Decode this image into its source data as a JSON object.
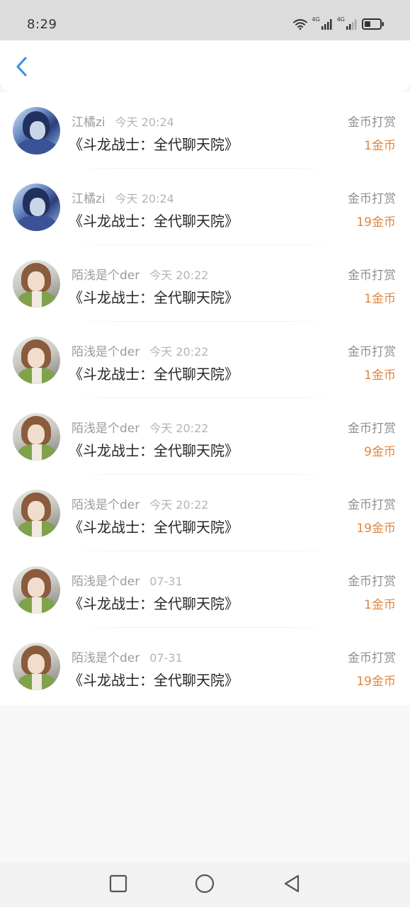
{
  "status_bar": {
    "time": "8:29",
    "network_1": "4G",
    "network_2": "4G",
    "icons": [
      "wifi-icon",
      "signal-icon",
      "signal-icon",
      "battery-icon"
    ]
  },
  "header": {
    "back_icon": "chevron-left-icon"
  },
  "records": [
    {
      "avatar": "blue",
      "name": "江橘zi",
      "time": "今天 20:24",
      "content": "《斗龙战士：全代聊天院》",
      "type": "金币打赏",
      "amount": "1金币"
    },
    {
      "avatar": "blue",
      "name": "江橘zi",
      "time": "今天 20:24",
      "content": "《斗龙战士：全代聊天院》",
      "type": "金币打赏",
      "amount": "19金币"
    },
    {
      "avatar": "green",
      "name": "陌浅是个der",
      "time": "今天 20:22",
      "content": "《斗龙战士：全代聊天院》",
      "type": "金币打赏",
      "amount": "1金币"
    },
    {
      "avatar": "green",
      "name": "陌浅是个der",
      "time": "今天 20:22",
      "content": "《斗龙战士：全代聊天院》",
      "type": "金币打赏",
      "amount": "1金币"
    },
    {
      "avatar": "green",
      "name": "陌浅是个der",
      "time": "今天 20:22",
      "content": "《斗龙战士：全代聊天院》",
      "type": "金币打赏",
      "amount": "9金币"
    },
    {
      "avatar": "green",
      "name": "陌浅是个der",
      "time": "今天 20:22",
      "content": "《斗龙战士：全代聊天院》",
      "type": "金币打赏",
      "amount": "19金币"
    },
    {
      "avatar": "green",
      "name": "陌浅是个der",
      "time": "07-31",
      "content": "《斗龙战士：全代聊天院》",
      "type": "金币打赏",
      "amount": "1金币"
    },
    {
      "avatar": "green",
      "name": "陌浅是个der",
      "time": "07-31",
      "content": "《斗龙战士：全代聊天院》",
      "type": "金币打赏",
      "amount": "19金币"
    }
  ],
  "nav_bar": {
    "icons": [
      "square-icon",
      "circle-icon",
      "triangle-back-icon"
    ]
  },
  "colors": {
    "accent": "#3a8ee6",
    "amount": "#e0853e",
    "status_bar_bg": "#dcdcdc",
    "page_bg": "#f8f7f8"
  }
}
